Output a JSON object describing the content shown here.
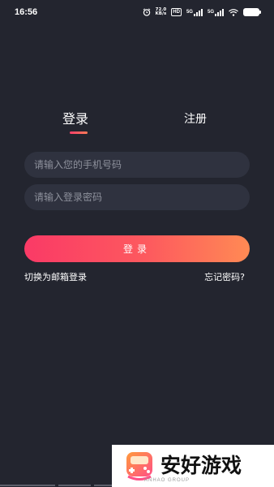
{
  "status_bar": {
    "time": "16:56",
    "speed_value": "72.0",
    "speed_unit": "KB/s",
    "hd_label": "HD",
    "signal1_label": "5G",
    "signal2_label": "5G",
    "battery_level": "full"
  },
  "tabs": {
    "login": "登录",
    "register": "注册",
    "active": "login"
  },
  "form": {
    "phone_placeholder": "请输入您的手机号码",
    "password_placeholder": "请输入登录密码",
    "login_button": "登录",
    "switch_email": "切换为邮箱登录",
    "forgot_password": "忘记密码?"
  },
  "watermark": {
    "title": "安好游戏",
    "subtitle": "ANHAO GROUP"
  },
  "colors": {
    "background": "#23252f",
    "input_bg": "#2f323f",
    "accent_start": "#fa3a66",
    "accent_end": "#ff8a54"
  }
}
